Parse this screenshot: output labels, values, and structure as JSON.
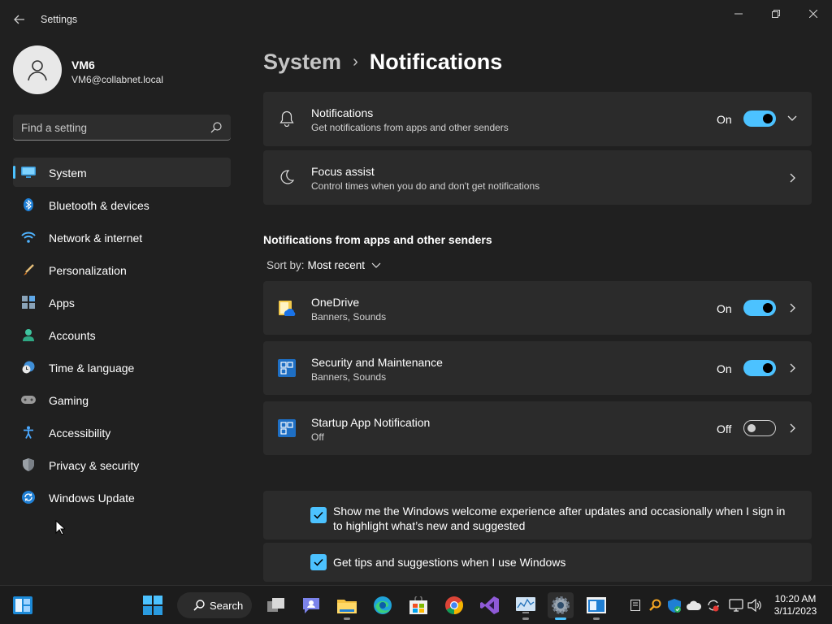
{
  "window": {
    "title": "Settings"
  },
  "profile": {
    "name": "VM6",
    "email": "VM6@collabnet.local"
  },
  "search": {
    "placeholder": "Find a setting"
  },
  "sidebar": {
    "items": [
      {
        "label": "System",
        "icon": "monitor-icon",
        "active": true
      },
      {
        "label": "Bluetooth & devices",
        "icon": "bluetooth-icon"
      },
      {
        "label": "Network & internet",
        "icon": "wifi-icon"
      },
      {
        "label": "Personalization",
        "icon": "brush-icon"
      },
      {
        "label": "Apps",
        "icon": "apps-icon"
      },
      {
        "label": "Accounts",
        "icon": "person-icon"
      },
      {
        "label": "Time & language",
        "icon": "clock-globe-icon"
      },
      {
        "label": "Gaming",
        "icon": "gamepad-icon"
      },
      {
        "label": "Accessibility",
        "icon": "accessibility-icon"
      },
      {
        "label": "Privacy & security",
        "icon": "shield-icon"
      },
      {
        "label": "Windows Update",
        "icon": "update-icon"
      }
    ]
  },
  "breadcrumb": {
    "parent": "System",
    "current": "Notifications"
  },
  "notifications": {
    "title": "Notifications",
    "subtitle": "Get notifications from apps and other senders",
    "state": "On"
  },
  "focus_assist": {
    "title": "Focus assist",
    "subtitle": "Control times when you do and don't get notifications"
  },
  "senders": {
    "heading": "Notifications from apps and other senders",
    "sort_label": "Sort by:",
    "sort_value": "Most recent",
    "apps": [
      {
        "name": "OneDrive",
        "detail": "Banners, Sounds",
        "state": "On",
        "icon": "onedrive-icon"
      },
      {
        "name": "Security and Maintenance",
        "detail": "Banners, Sounds",
        "state": "On",
        "icon": "security-maintenance-icon"
      },
      {
        "name": "Startup App Notification",
        "detail": "Off",
        "state": "Off",
        "icon": "startup-app-icon"
      }
    ]
  },
  "options": {
    "welcome": "Show me the Windows welcome experience after updates and occasionally when I sign in to highlight what’s new and suggested",
    "tips": "Get tips and suggestions when I use Windows"
  },
  "taskbar": {
    "search_label": "Search",
    "time": "10:20 AM",
    "date": "3/11/2023"
  },
  "colors": {
    "accent": "#4cc2ff",
    "background": "#202020",
    "card": "#2b2b2b"
  }
}
